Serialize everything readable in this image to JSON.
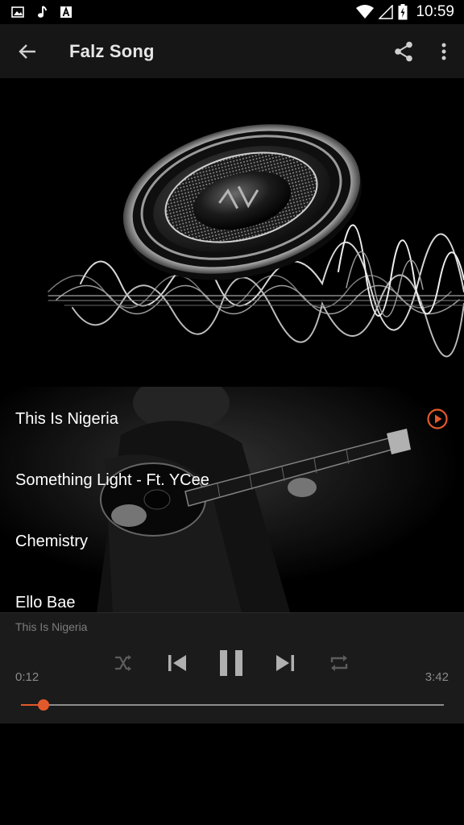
{
  "status_bar": {
    "time": "10:59",
    "left_icons": [
      "image-icon",
      "music-note-icon",
      "font-a-icon"
    ],
    "right_icons": [
      "wifi-icon",
      "signal-icon",
      "battery-icon"
    ]
  },
  "app_bar": {
    "title": "Falz Song",
    "back_icon": "arrow-left-icon",
    "share_icon": "share-icon",
    "menu_icon": "more-vert-icon",
    "background": "#161616"
  },
  "songs": [
    {
      "title": "This Is Nigeria",
      "playing": true
    },
    {
      "title": "Something Light - Ft. YCee",
      "playing": false
    },
    {
      "title": "Chemistry",
      "playing": false
    },
    {
      "title": "Ello Bae",
      "playing": false
    }
  ],
  "player": {
    "now_playing": "This Is Nigeria",
    "current_time": "0:12",
    "duration": "3:42",
    "progress_fraction": 0.054,
    "controls": [
      "shuffle-icon",
      "previous-icon",
      "pause-icon",
      "next-icon",
      "repeat-icon"
    ],
    "accent_color": "#e25a2b"
  }
}
